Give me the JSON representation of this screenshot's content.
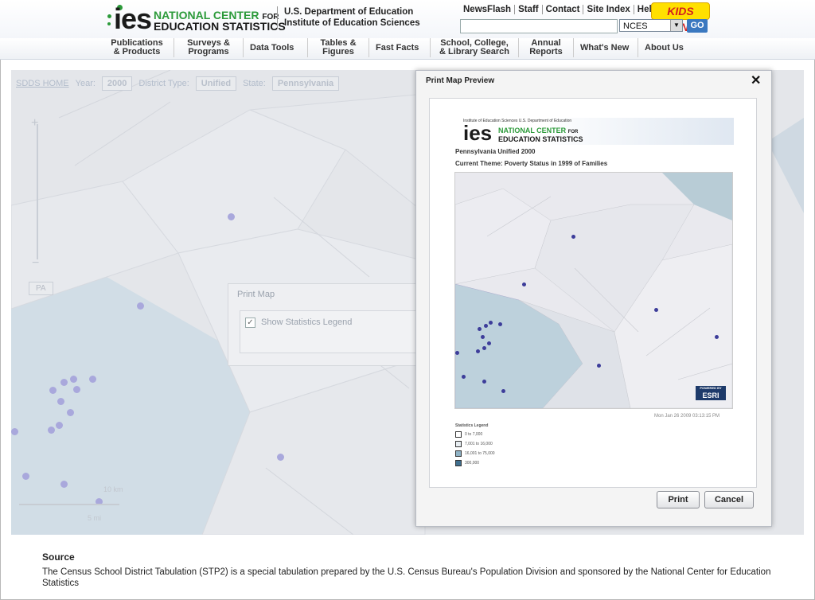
{
  "header": {
    "logo_ies": "ies",
    "logo_line1_a": "NATIONAL CENTER",
    "logo_line1_b": "FOR",
    "logo_line2": "EDUCATION STATISTICS",
    "dept_line1": "U.S. Department of Education",
    "dept_line2": "Institute of Education Sciences",
    "toplinks": [
      "NewsFlash",
      "Staff",
      "Contact",
      "Site Index",
      "Help"
    ],
    "kids_label": "KIDS ZONE",
    "search_select": "NCES",
    "go_label": "GO"
  },
  "nav": {
    "items": [
      "Publications & Products",
      "Surveys & Programs",
      "Data Tools",
      "Tables & Figures",
      "Fast Facts",
      "School, College, & Library Search",
      "Annual Reports",
      "What's New",
      "About Us"
    ]
  },
  "map": {
    "home_link": "SDDS HOME",
    "year_label": "Year:",
    "year_value": "2000",
    "district_label": "District Type:",
    "district_value": "Unified",
    "state_label": "State:",
    "state_value": "Pennsylvania",
    "state_badge": "PA",
    "scale_top": "10 km",
    "scale_bottom": "5 mi"
  },
  "print_map": {
    "title": "Print Map",
    "checkbox_label": "Show Statistics Legend",
    "checked_glyph": "✓"
  },
  "preview": {
    "title": "Print Map Preview",
    "close_glyph": "✕",
    "banner_small": "Institute of Education Sciences   U.S. Department of Education",
    "banner_ies": "ies",
    "banner_nc_a": "NATIONAL CENTER",
    "banner_nc_b": "FOR",
    "banner_nc2": "EDUCATION STATISTICS",
    "subtitle1": "Pennsylvania Unified 2000",
    "subtitle2": "Current Theme: Poverty Status in 1999 of Families",
    "esri_small": "POWERED BY",
    "esri": "ESRI",
    "timestamp": "Mon Jan 26 2009 03:13:15 PM",
    "legend_title": "Statistics Legend",
    "legend": [
      "0 to 7,000",
      "7,001 to 16,000",
      "16,001 to 75,000",
      "300,000"
    ],
    "legend_colors": [
      "#ffffff",
      "#e8eef2",
      "#8fb3c6",
      "#3f6f8f"
    ],
    "print_btn": "Print",
    "cancel_btn": "Cancel"
  },
  "source": {
    "heading": "Source",
    "text": "The Census School District Tabulation (STP2) is a special tabulation prepared by the U.S. Census Bureau's Population Division and sponsored by the National Center for Education Statistics"
  }
}
